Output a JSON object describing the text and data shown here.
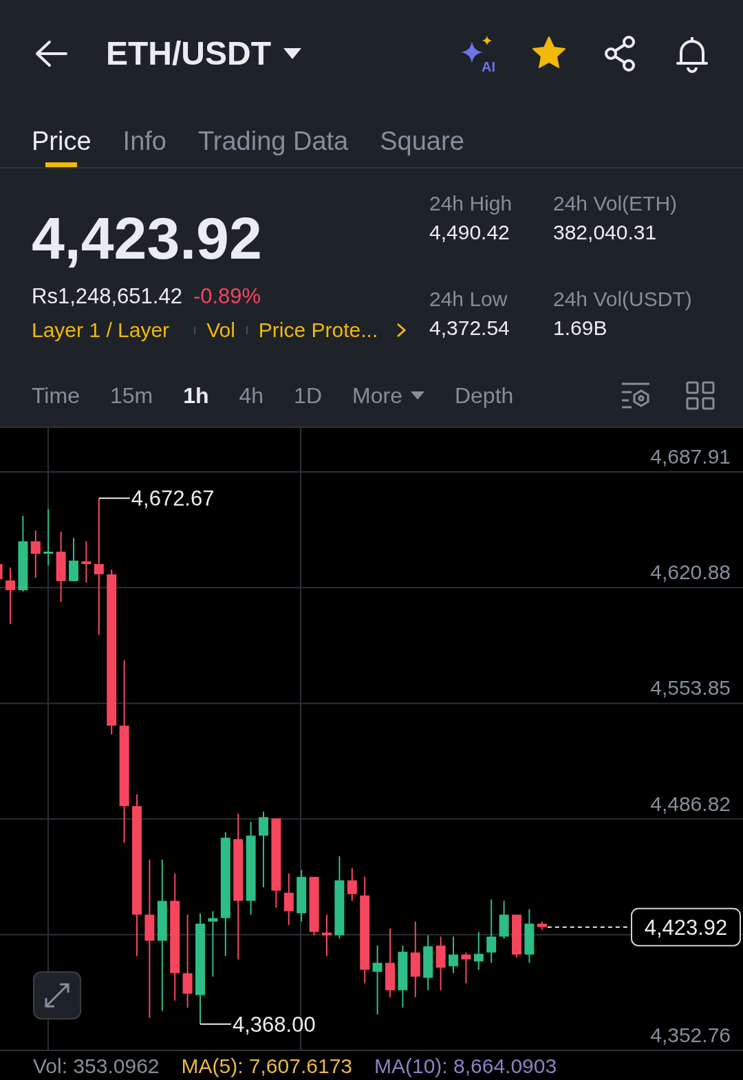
{
  "header": {
    "title": "ETH/USDT",
    "ai_label": "AI",
    "favorite": true
  },
  "tabs": [
    {
      "label": "Price",
      "selected": true
    },
    {
      "label": "Info",
      "selected": false
    },
    {
      "label": "Trading Data",
      "selected": false
    },
    {
      "label": "Square",
      "selected": false
    }
  ],
  "ticker": {
    "price": "4,423.92",
    "fiat_price": "Rs1,248,651.42",
    "change": "-0.89%",
    "tags": [
      "Layer 1 / Layer",
      "Vol",
      "Price Prote..."
    ],
    "stats": [
      {
        "label": "24h High",
        "value": "4,490.42"
      },
      {
        "label": "24h Vol(ETH)",
        "value": "382,040.31"
      },
      {
        "label": "24h Low",
        "value": "4,372.54"
      },
      {
        "label": "24h Vol(USDT)",
        "value": "1.69B"
      }
    ]
  },
  "intervals": [
    {
      "label": "Time",
      "kind": "option",
      "selected": false
    },
    {
      "label": "15m",
      "kind": "option",
      "selected": false
    },
    {
      "label": "1h",
      "kind": "option",
      "selected": true
    },
    {
      "label": "4h",
      "kind": "option",
      "selected": false
    },
    {
      "label": "1D",
      "kind": "option",
      "selected": false
    },
    {
      "label": "More",
      "kind": "dropdown",
      "selected": false
    },
    {
      "label": "Depth",
      "kind": "option",
      "selected": false
    }
  ],
  "chart": {
    "chart_data": {
      "type": "candlestick",
      "grid": true,
      "ylim": [
        4352.76,
        4687.91
      ],
      "yticks": [
        {
          "value": 4687.91,
          "label": "4,687.91"
        },
        {
          "value": 4620.88,
          "label": "4,620.88"
        },
        {
          "value": 4553.85,
          "label": "4,553.85"
        },
        {
          "value": 4486.82,
          "label": "4,486.82"
        },
        {
          "value": 4352.76,
          "label": "4,352.76"
        }
      ],
      "ohlc": [
        [
          4634.5,
          4634.5,
          4622.6,
          4625.8
        ],
        [
          4625.0,
          4632.5,
          4599.9,
          4619.4
        ],
        [
          4619.4,
          4662.4,
          4618.6,
          4647.7
        ],
        [
          4647.7,
          4654.0,
          4626.6,
          4640.5
        ],
        [
          4640.9,
          4666.4,
          4633.7,
          4641.7
        ],
        [
          4641.7,
          4653.3,
          4612.6,
          4624.6
        ],
        [
          4624.6,
          4649.7,
          4624.6,
          4636.5
        ],
        [
          4636.1,
          4647.7,
          4623.8,
          4634.5
        ],
        [
          4634.5,
          4672.67,
          4593.5,
          4628.6
        ],
        [
          4628.6,
          4631.3,
          4535.8,
          4540.9
        ],
        [
          4540.9,
          4578.8,
          4473.2,
          4494.3
        ],
        [
          4494.3,
          4501.1,
          4407.5,
          4431.4
        ],
        [
          4431.4,
          4463.3,
          4371.6,
          4416.3
        ],
        [
          4416.3,
          4463.3,
          4375.6,
          4439.4
        ],
        [
          4439.4,
          4455.3,
          4381.6,
          4397.5
        ],
        [
          4397.5,
          4431.4,
          4377.6,
          4385.6
        ],
        [
          4384.8,
          4432.2,
          4368.0,
          4426.2
        ],
        [
          4427.4,
          4433.4,
          4395.5,
          4429.4
        ],
        [
          4429.4,
          4479.2,
          4407.5,
          4476.0
        ],
        [
          4475.2,
          4489.9,
          4405.5,
          4439.4
        ],
        [
          4439.4,
          4485.2,
          4431.4,
          4477.2
        ],
        [
          4477.2,
          4491.1,
          4447.3,
          4487.9
        ],
        [
          4487.2,
          4487.2,
          4435.4,
          4445.3
        ],
        [
          4444.1,
          4455.3,
          4425.4,
          4433.4
        ],
        [
          4432.2,
          4457.3,
          4427.4,
          4453.3
        ],
        [
          4453.3,
          4453.3,
          4419.4,
          4421.4
        ],
        [
          4421.0,
          4431.4,
          4407.5,
          4419.4
        ],
        [
          4419.4,
          4465.3,
          4417.5,
          4451.3
        ],
        [
          4451.3,
          4458.5,
          4439.4,
          4443.3
        ],
        [
          4442.5,
          4453.3,
          4391.6,
          4399.5
        ],
        [
          4398.3,
          4413.5,
          4373.6,
          4403.5
        ],
        [
          4403.5,
          4423.4,
          4383.6,
          4387.6
        ],
        [
          4387.6,
          4413.5,
          4377.6,
          4409.9
        ],
        [
          4409.5,
          4427.4,
          4383.6,
          4395.5
        ],
        [
          4394.8,
          4419.4,
          4387.6,
          4413.1
        ],
        [
          4413.5,
          4418.7,
          4387.6,
          4400.7
        ],
        [
          4401.5,
          4418.7,
          4397.5,
          4408.3
        ],
        [
          4408.3,
          4409.5,
          4391.6,
          4405.5
        ],
        [
          4404.3,
          4421.4,
          4399.5,
          4408.7
        ],
        [
          4409.5,
          4440.2,
          4403.5,
          4418.7
        ],
        [
          4418.7,
          4439.4,
          4417.5,
          4431.4
        ],
        [
          4431.4,
          4431.4,
          4406.7,
          4408.3
        ],
        [
          4408.3,
          4434.6,
          4403.5,
          4426.2
        ],
        [
          4426.2,
          4427.4,
          4422.6,
          4424.2
        ]
      ],
      "annotations": [
        "4,672.67",
        "4,368.00"
      ]
    },
    "last_price": "4,423.92"
  },
  "indicators": [
    {
      "label": "Vol: 353.0962",
      "color": "#848e9c"
    },
    {
      "label": "MA(5): 7,607.6173",
      "color": "#e9b949"
    },
    {
      "label": "MA(10): 8,664.0903",
      "color": "#8a82c0"
    }
  ]
}
